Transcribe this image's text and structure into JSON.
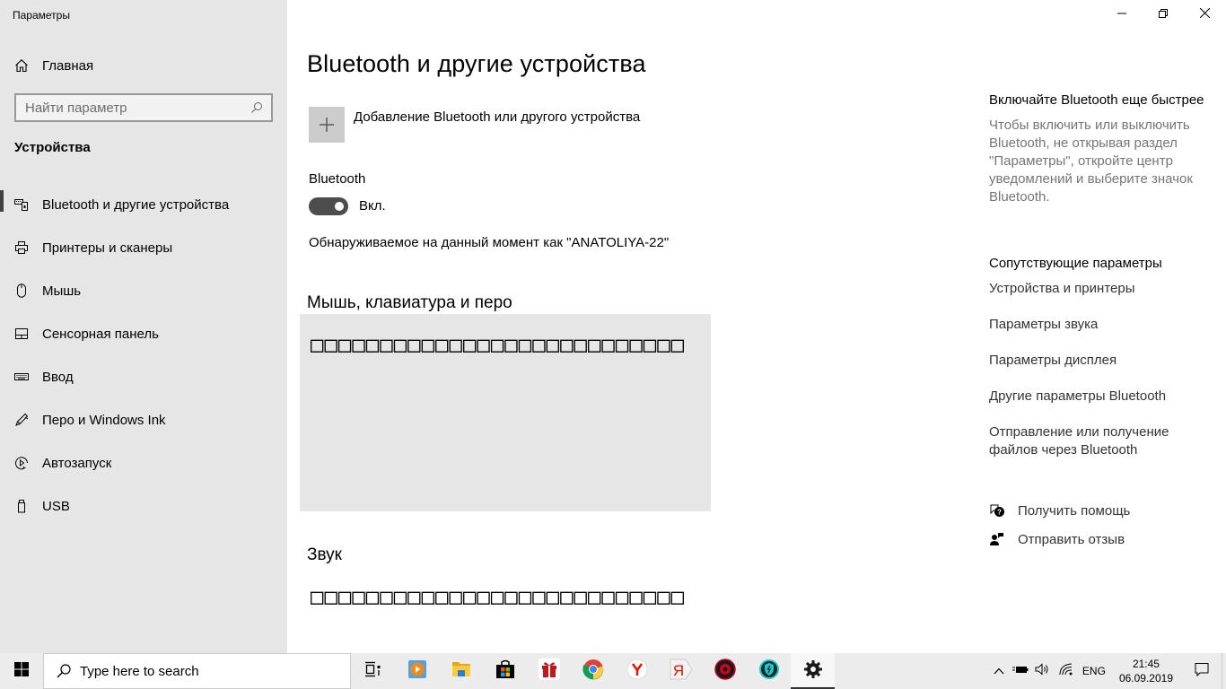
{
  "app": {
    "title": "Параметры",
    "window_controls": {
      "minimize": "minimize",
      "restore": "restore",
      "close": "close"
    }
  },
  "sidebar": {
    "home_label": "Главная",
    "search_placeholder": "Найти параметр",
    "section_title": "Устройства",
    "items": [
      {
        "label": "Bluetooth и другие устройства",
        "icon": "bluetooth-devices-icon",
        "active": true
      },
      {
        "label": "Принтеры и сканеры",
        "icon": "printer-icon",
        "active": false
      },
      {
        "label": "Мышь",
        "icon": "mouse-icon",
        "active": false
      },
      {
        "label": "Сенсорная панель",
        "icon": "touchpad-icon",
        "active": false
      },
      {
        "label": "Ввод",
        "icon": "keyboard-icon",
        "active": false
      },
      {
        "label": "Перо и Windows Ink",
        "icon": "pen-icon",
        "active": false
      },
      {
        "label": "Автозапуск",
        "icon": "autoplay-icon",
        "active": false
      },
      {
        "label": "USB",
        "icon": "usb-icon",
        "active": false
      }
    ]
  },
  "main": {
    "page_title": "Bluetooth и другие устройства",
    "add_device_label": "Добавление Bluetooth или другого устройства",
    "bluetooth_label": "Bluetooth",
    "bluetooth_on": true,
    "toggle_state": "Вкл.",
    "discoverable_text": "Обнаруживаемое на данный момент как \"ANATOLIYA-22\"",
    "sections": [
      {
        "title": "Мышь, клавиатура и перо",
        "content": "□□□□□□□□□□□□□□□□□□□□□□□□□□□"
      },
      {
        "title": "Звук",
        "content": "□□□□□□□□□□□□□□□□□□□□□□□□□□□"
      }
    ]
  },
  "right_panel": {
    "tip_title": "Включайте Bluetooth еще быстрее",
    "tip_text": "Чтобы включить или выключить Bluetooth, не открывая раздел \"Параметры\", откройте центр уведомлений и выберите значок Bluetooth.",
    "related_title": "Сопутствующие параметры",
    "related_links": [
      "Устройства и принтеры",
      "Параметры звука",
      "Параметры дисплея",
      "Другие параметры Bluetooth",
      "Отправление или получение файлов через Bluetooth"
    ],
    "help_label": "Получить помощь",
    "feedback_label": "Отправить отзыв"
  },
  "taskbar": {
    "search_placeholder": "Type here to search",
    "apps": [
      {
        "name": "task-view"
      },
      {
        "name": "media-player"
      },
      {
        "name": "file-explorer"
      },
      {
        "name": "microsoft-store"
      },
      {
        "name": "gift-app"
      },
      {
        "name": "chrome"
      },
      {
        "name": "yandex-browser"
      },
      {
        "name": "yandex"
      },
      {
        "name": "red-shield-app"
      },
      {
        "name": "teal-shield-app"
      },
      {
        "name": "settings",
        "active": true
      }
    ],
    "tray": {
      "language": "ENG",
      "time": "21:45",
      "date": "06.09.2019"
    }
  },
  "colors": {
    "sidebar_bg": "#e6e6e6",
    "toggle_on": "#4d4d4d",
    "muted_text": "#767676",
    "taskbar_bg": "#ececec"
  }
}
